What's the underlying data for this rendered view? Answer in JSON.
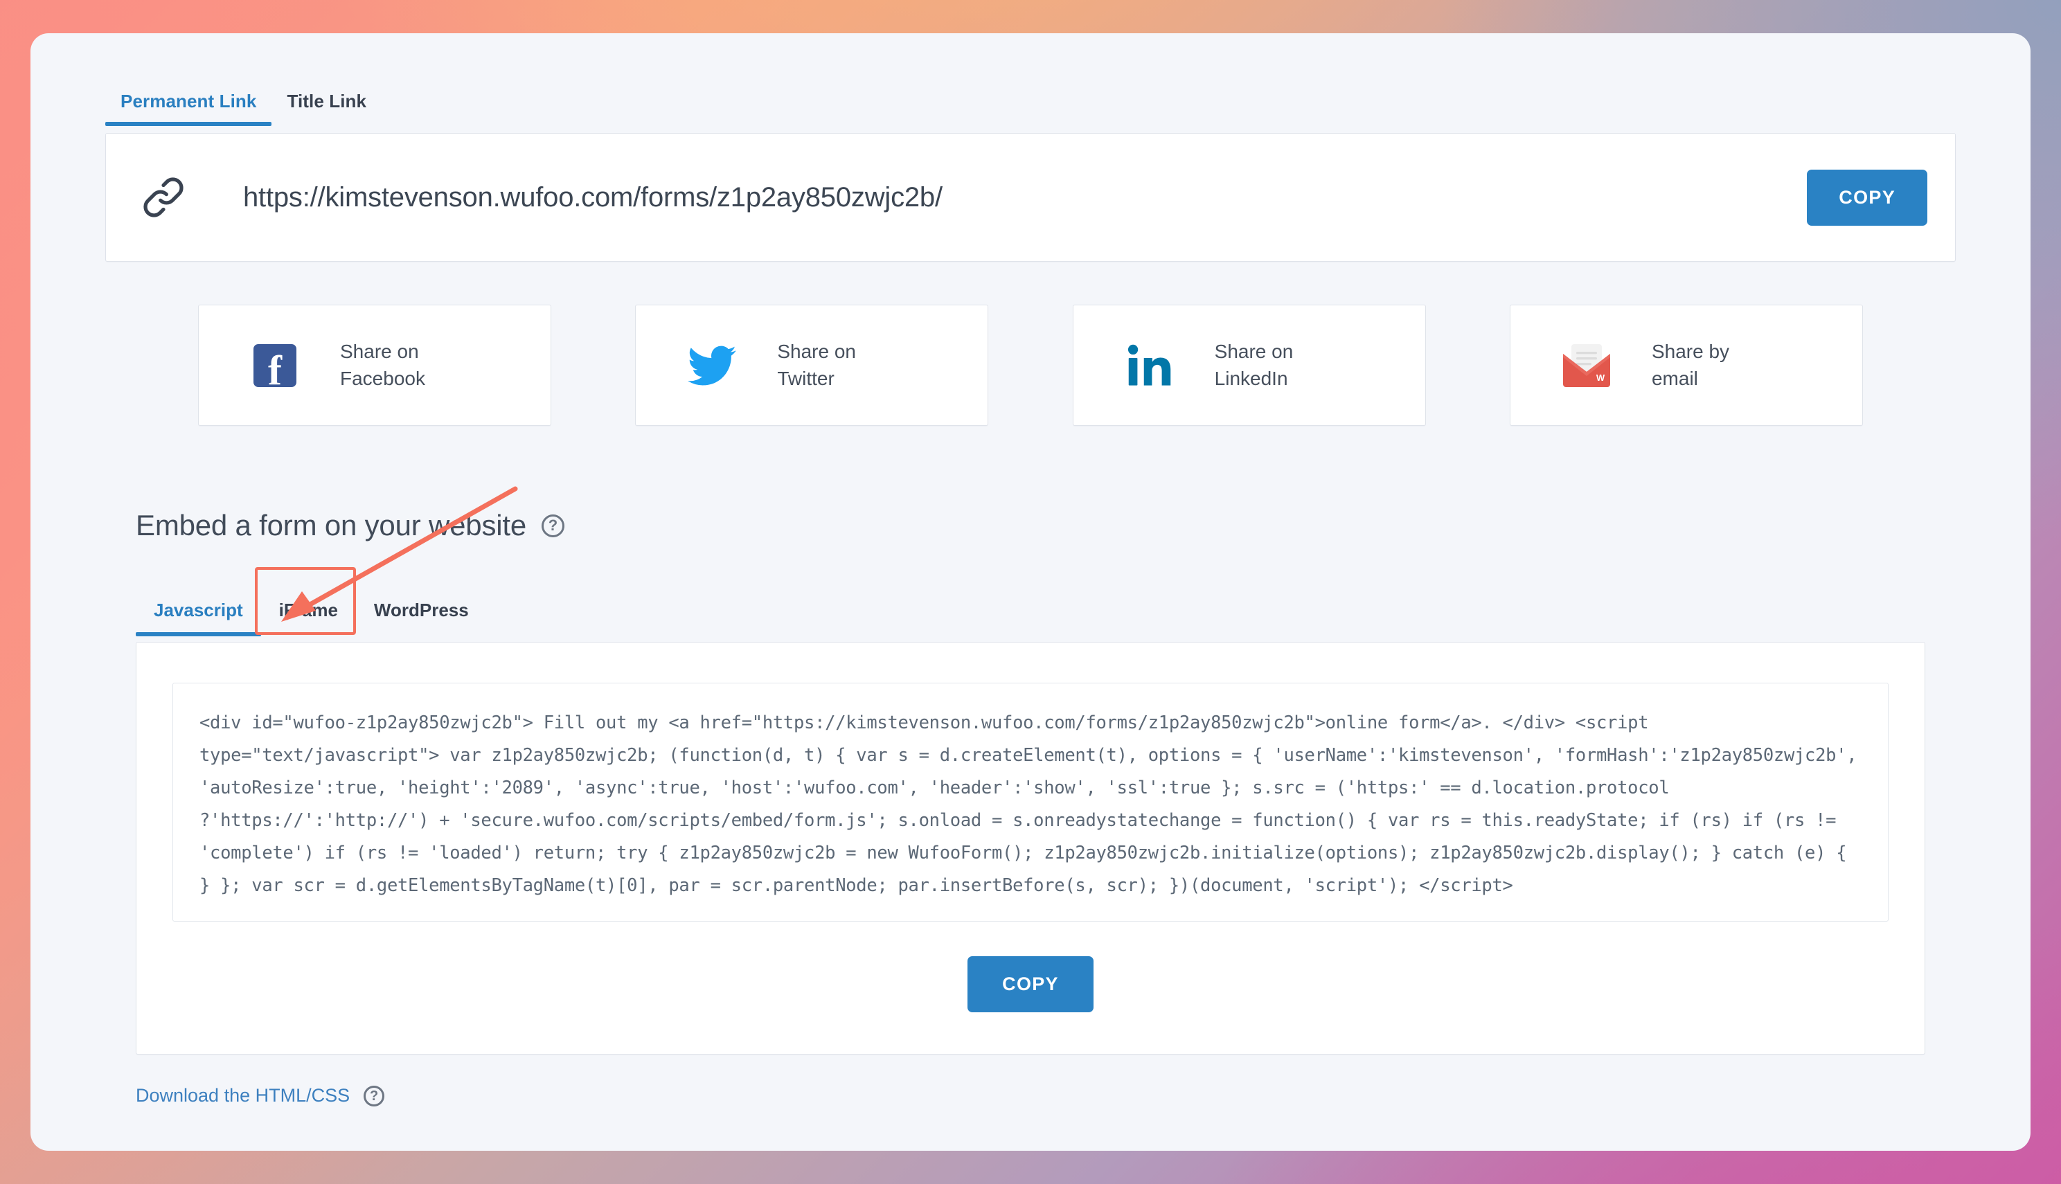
{
  "top_tabs": [
    {
      "label": "Permanent Link",
      "active": true
    },
    {
      "label": "Title Link",
      "active": false
    }
  ],
  "link_panel": {
    "icon": "link-icon",
    "url": "https://kimstevenson.wufoo.com/forms/z1p2ay850zwjc2b/",
    "copy_label": "COPY"
  },
  "share_buttons": [
    {
      "icon": "facebook-icon",
      "label": "Share on\nFacebook"
    },
    {
      "icon": "twitter-icon",
      "label": "Share on\nTwitter"
    },
    {
      "icon": "linkedin-icon",
      "label": "Share on\nLinkedIn"
    },
    {
      "icon": "email-icon",
      "label": "Share by\nemail"
    }
  ],
  "embed": {
    "title": "Embed a form on your website",
    "help_icon": "help-icon",
    "tabs": [
      {
        "label": "Javascript",
        "active": true
      },
      {
        "label": "iFrame",
        "active": false,
        "annotated": true
      },
      {
        "label": "WordPress",
        "active": false
      }
    ],
    "code": "<div id=\"wufoo-z1p2ay850zwjc2b\"> Fill out my <a href=\"https://kimstevenson.wufoo.com/forms/z1p2ay850zwjc2b\">online form</a>. </div> <script type=\"text/javascript\"> var z1p2ay850zwjc2b; (function(d, t) { var s = d.createElement(t), options = { 'userName':'kimstevenson', 'formHash':'z1p2ay850zwjc2b', 'autoResize':true, 'height':'2089', 'async':true, 'host':'wufoo.com', 'header':'show', 'ssl':true }; s.src = ('https:' == d.location.protocol ?'https://':'http://') + 'secure.wufoo.com/scripts/embed/form.js'; s.onload = s.onreadystatechange = function() { var rs = this.readyState; if (rs) if (rs != 'complete') if (rs != 'loaded') return; try { z1p2ay850zwjc2b = new WufooForm(); z1p2ay850zwjc2b.initialize(options); z1p2ay850zwjc2b.display(); } catch (e) { } }; var scr = d.getElementsByTagName(t)[0], par = scr.parentNode; par.insertBefore(s, scr); })(document, 'script'); </script>",
    "copy_label": "COPY"
  },
  "footer": {
    "download_label": "Download the HTML/CSS",
    "help_icon": "help-icon"
  },
  "colors": {
    "accent_blue": "#2a82c4",
    "link_blue": "#3d80bf",
    "annotation_red": "#f4705c",
    "facebook": "#3b5998",
    "twitter": "#1da1f2",
    "linkedin": "#0277a8",
    "email_red": "#e2574c",
    "card_bg": "#f4f6fa"
  }
}
